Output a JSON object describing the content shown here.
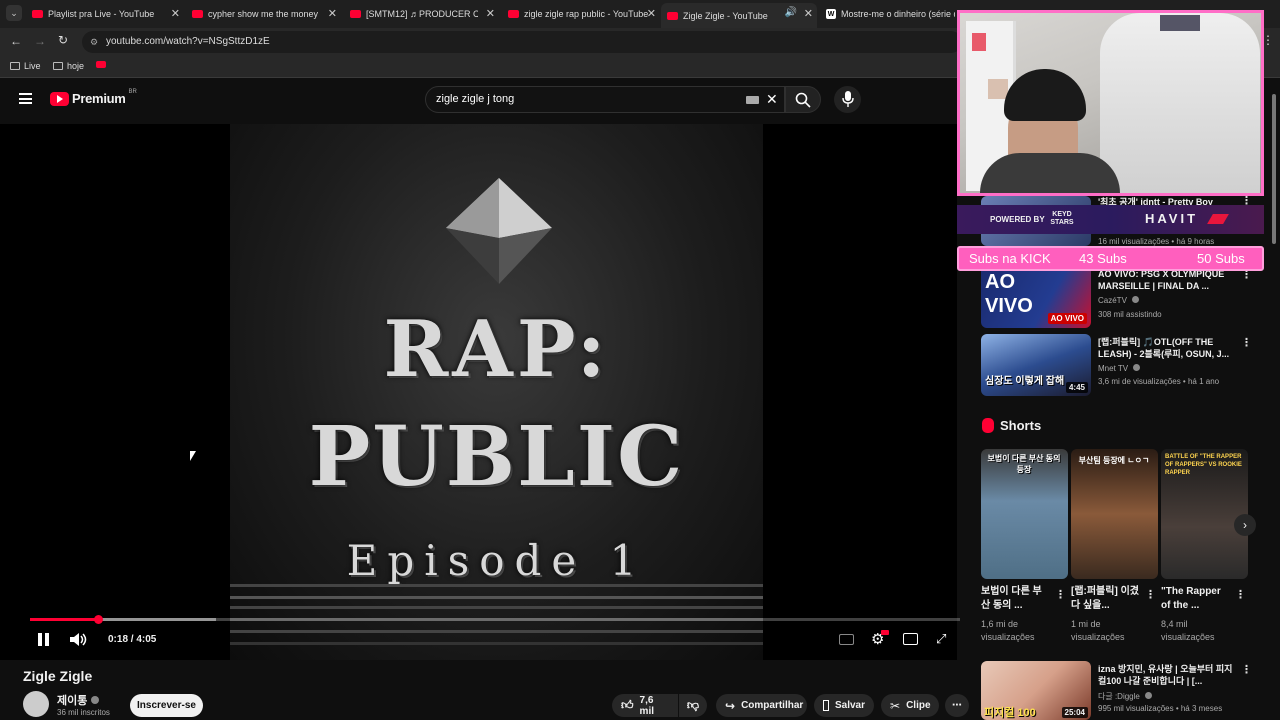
{
  "browser": {
    "tabs": [
      {
        "title": "Playlist pra Live - YouTube",
        "icon": "youtube-icon"
      },
      {
        "title": "cypher show me the money - Y",
        "icon": "youtube-icon"
      },
      {
        "title": "[SMTM12] ♬PRODUCER CYPHE",
        "icon": "youtube-icon"
      },
      {
        "title": "zigle zigle rap public - YouTube",
        "icon": "youtube-icon"
      },
      {
        "title": "Zigle Zigle - YouTube",
        "icon": "youtube-icon"
      },
      {
        "title": "Mostre-me o dinheiro (série de",
        "icon": "wikipedia-icon"
      }
    ],
    "url": "youtube.com/watch?v=NSgSttzD1zE",
    "bookmarks": [
      "Live",
      "hoje"
    ]
  },
  "header": {
    "brand": "Premium",
    "region": "BR",
    "search_value": "zigle zigle j tong"
  },
  "player": {
    "art_title_line1": "RAP:",
    "art_title_line2": "PUBLIC",
    "art_episode": "Episode 1",
    "time": "0:18 / 4:05",
    "progress": 0.073,
    "buffered": 0.2
  },
  "video": {
    "title": "Zigle Zigle",
    "channel": "제이통",
    "subscribers": "36 mil inscritos",
    "subscribe_label": "Inscrever-se",
    "likes": "7,6 mil",
    "share_label": "Compartilhar",
    "save_label": "Salvar",
    "clip_label": "Clipe"
  },
  "sidebar": {
    "videos": [
      {
        "title": "'최초 공개' idntt - Pretty Boy",
        "meta": "16 mil visualizações • há 9 horas"
      },
      {
        "title": "AO VIVO: PSG X OLYMPIQUE MARSEILLE | FINAL DA ...",
        "channel": "CazéTV",
        "meta": "308 mil assistindo",
        "badge": "AO VIVO",
        "thumb_text": "AO VIVO"
      },
      {
        "title": "[랩:퍼블릭] 🎵OTL(OFF THE LEASH) - 2블록(루피, OSUN, J...",
        "channel": "Mnet TV",
        "meta": "3,6 mi de visualizações • há 1 ano",
        "duration": "4:45",
        "thumb_text": "심장도 이렇게 잡해"
      },
      {
        "title": "izna 방지민, 유사랑 | 오늘부터 피지컬100 나갈 준비합니다 | [...",
        "channel": "다글 :Diggle",
        "meta": "995 mil visualizações • há 3 meses",
        "duration": "25:04",
        "thumb_text": "피지컬 100"
      }
    ],
    "shorts_label": "Shorts",
    "shorts": [
      {
        "title": "보법이 다른 부산 동의 ...",
        "views": "1,6 mi de visualizações",
        "thumb_text": "보법이 다른 부산 동의 등장"
      },
      {
        "title": "[랩:퍼블릭] 이겼다 싶을...",
        "views": "1 mi de visualizações",
        "thumb_text": "부산팀 등장에 ㄴㅇㄱ"
      },
      {
        "title": "\"The Rapper of the ...",
        "views": "8,4 mil visualizações",
        "thumb_text": "BATTLE OF \"THE RAPPER OF RAPPERS\" VS ROOKIE RAPPER"
      }
    ]
  },
  "overlays": {
    "sponsor_powered": "POWERED BY",
    "sponsor_brand1": "KEYD STARS",
    "sponsor_brand2": "HAVIT",
    "kick_label": "Subs na KICK",
    "kick_current": "43 Subs",
    "kick_goal": "50 Subs"
  },
  "colors": {
    "youtube_red": "#ff0033",
    "kick_pink": "#ff5fbe",
    "background": "#0f0f0f"
  }
}
